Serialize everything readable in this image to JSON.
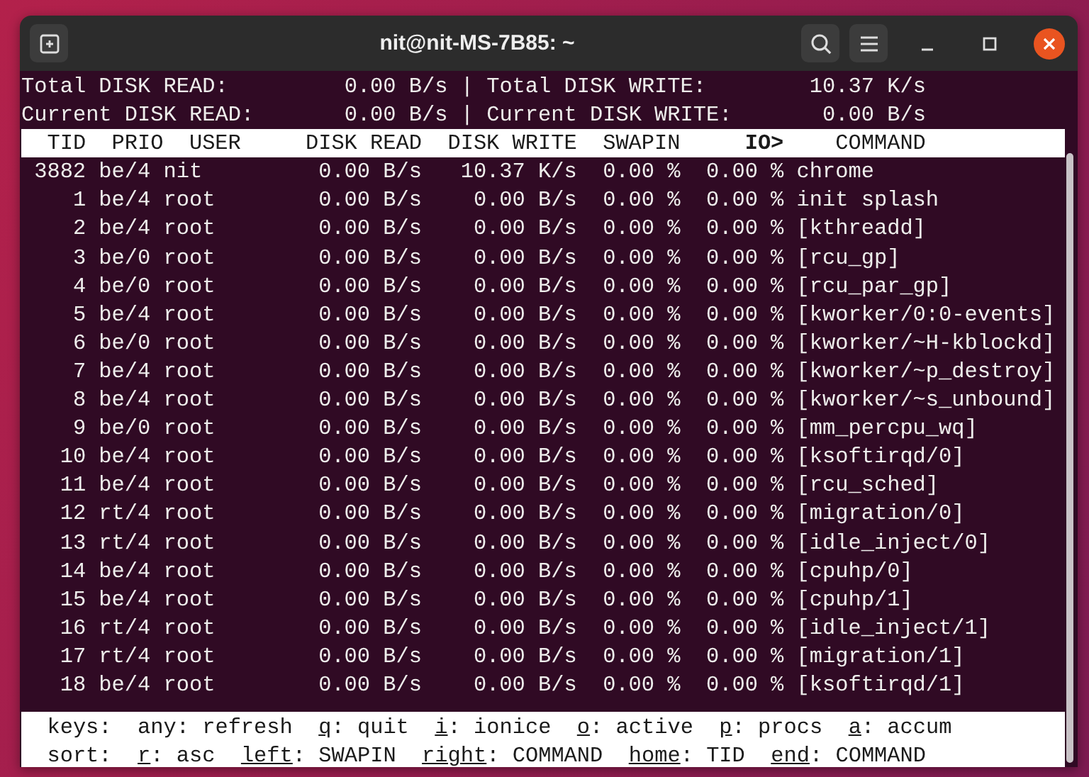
{
  "window": {
    "title": "nit@nit-MS-7B85: ~"
  },
  "summary": [
    {
      "label": "Total DISK READ:",
      "value": "0.00 B/s",
      "separator": "|",
      "label_2": "Total DISK WRITE:",
      "value_2": "10.37 K/s"
    },
    {
      "label": "Current DISK READ:",
      "value": "0.00 B/s",
      "separator": "|",
      "label_2": "Current DISK WRITE:",
      "value_2": "0.00 B/s"
    }
  ],
  "columns": [
    {
      "label": "TID",
      "sorted": false
    },
    {
      "label": "PRIO",
      "sorted": false
    },
    {
      "label": "USER",
      "sorted": false
    },
    {
      "label": "DISK READ",
      "sorted": false
    },
    {
      "label": "DISK WRITE",
      "sorted": false
    },
    {
      "label": "SWAPIN",
      "sorted": false
    },
    {
      "label": "IO>",
      "sorted": true
    },
    {
      "label": "COMMAND",
      "sorted": false
    }
  ],
  "rows": [
    [
      "3882",
      "be/4",
      "nit",
      "0.00 B/s",
      "10.37 K/s",
      "0.00 %",
      "0.00 %",
      "chrome"
    ],
    [
      "1",
      "be/4",
      "root",
      "0.00 B/s",
      "0.00 B/s",
      "0.00 %",
      "0.00 %",
      "init splash"
    ],
    [
      "2",
      "be/4",
      "root",
      "0.00 B/s",
      "0.00 B/s",
      "0.00 %",
      "0.00 %",
      "[kthreadd]"
    ],
    [
      "3",
      "be/0",
      "root",
      "0.00 B/s",
      "0.00 B/s",
      "0.00 %",
      "0.00 %",
      "[rcu_gp]"
    ],
    [
      "4",
      "be/0",
      "root",
      "0.00 B/s",
      "0.00 B/s",
      "0.00 %",
      "0.00 %",
      "[rcu_par_gp]"
    ],
    [
      "5",
      "be/4",
      "root",
      "0.00 B/s",
      "0.00 B/s",
      "0.00 %",
      "0.00 %",
      "[kworker/0:0-events]"
    ],
    [
      "6",
      "be/0",
      "root",
      "0.00 B/s",
      "0.00 B/s",
      "0.00 %",
      "0.00 %",
      "[kworker/~H-kblockd]"
    ],
    [
      "7",
      "be/4",
      "root",
      "0.00 B/s",
      "0.00 B/s",
      "0.00 %",
      "0.00 %",
      "[kworker/~p_destroy]"
    ],
    [
      "8",
      "be/4",
      "root",
      "0.00 B/s",
      "0.00 B/s",
      "0.00 %",
      "0.00 %",
      "[kworker/~s_unbound]"
    ],
    [
      "9",
      "be/0",
      "root",
      "0.00 B/s",
      "0.00 B/s",
      "0.00 %",
      "0.00 %",
      "[mm_percpu_wq]"
    ],
    [
      "10",
      "be/4",
      "root",
      "0.00 B/s",
      "0.00 B/s",
      "0.00 %",
      "0.00 %",
      "[ksoftirqd/0]"
    ],
    [
      "11",
      "be/4",
      "root",
      "0.00 B/s",
      "0.00 B/s",
      "0.00 %",
      "0.00 %",
      "[rcu_sched]"
    ],
    [
      "12",
      "rt/4",
      "root",
      "0.00 B/s",
      "0.00 B/s",
      "0.00 %",
      "0.00 %",
      "[migration/0]"
    ],
    [
      "13",
      "rt/4",
      "root",
      "0.00 B/s",
      "0.00 B/s",
      "0.00 %",
      "0.00 %",
      "[idle_inject/0]"
    ],
    [
      "14",
      "be/4",
      "root",
      "0.00 B/s",
      "0.00 B/s",
      "0.00 %",
      "0.00 %",
      "[cpuhp/0]"
    ],
    [
      "15",
      "be/4",
      "root",
      "0.00 B/s",
      "0.00 B/s",
      "0.00 %",
      "0.00 %",
      "[cpuhp/1]"
    ],
    [
      "16",
      "rt/4",
      "root",
      "0.00 B/s",
      "0.00 B/s",
      "0.00 %",
      "0.00 %",
      "[idle_inject/1]"
    ],
    [
      "17",
      "rt/4",
      "root",
      "0.00 B/s",
      "0.00 B/s",
      "0.00 %",
      "0.00 %",
      "[migration/1]"
    ],
    [
      "18",
      "be/4",
      "root",
      "0.00 B/s",
      "0.00 B/s",
      "0.00 %",
      "0.00 %",
      "[ksoftirqd/1]"
    ]
  ],
  "footer": [
    {
      "label": "keys:",
      "items": [
        {
          "key": "any",
          "underlined": false,
          "action": ": refresh"
        },
        {
          "key": "q",
          "underlined": true,
          "action": ": quit"
        },
        {
          "key": "i",
          "underlined": true,
          "action": ": ionice"
        },
        {
          "key": "o",
          "underlined": true,
          "action": ": active"
        },
        {
          "key": "p",
          "underlined": true,
          "action": ": procs"
        },
        {
          "key": "a",
          "underlined": true,
          "action": ": accum"
        }
      ]
    },
    {
      "label": "sort:",
      "items": [
        {
          "key": "r",
          "underlined": true,
          "action": ": asc"
        },
        {
          "key": "left",
          "underlined": true,
          "action": ": SWAPIN"
        },
        {
          "key": "right",
          "underlined": true,
          "action": ": COMMAND"
        },
        {
          "key": "home",
          "underlined": true,
          "action": ": TID"
        },
        {
          "key": "end",
          "underlined": true,
          "action": ": COMMAND"
        }
      ]
    }
  ]
}
